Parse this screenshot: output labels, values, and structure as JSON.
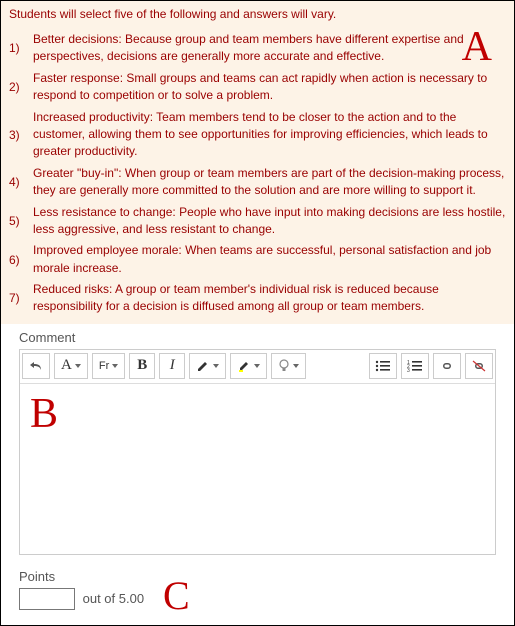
{
  "instruction": "Students will select five of the following and answers will vary.",
  "items": [
    {
      "n": "1)",
      "text": "Better decisions: Because group and team members have different expertise and perspectives, decisions are generally more accurate and effective."
    },
    {
      "n": "2)",
      "text": "Faster response: Small groups and teams can act rapidly when action is necessary to respond to competition or to solve a problem."
    },
    {
      "n": "3)",
      "text": "Increased productivity: Team members tend to be closer to the action and to the customer, allowing them to see opportunities for improving efficiencies, which leads to greater productivity."
    },
    {
      "n": "4)",
      "text": "Greater \"buy-in\": When group or team members are part of the decision-making process, they are generally more committed to the solution and are more willing to support it."
    },
    {
      "n": "5)",
      "text": "Less resistance to change: People who have input into making decisions are less hostile, less aggressive, and less resistant to change."
    },
    {
      "n": "6)",
      "text": "Improved employee morale: When teams are successful, personal satisfaction and job morale increase."
    },
    {
      "n": "7)",
      "text": "Reduced risks: A group or team member's individual risk is reduced because responsibility for a decision is diffused among all group or team members."
    }
  ],
  "comment_label": "Comment",
  "toolbar": {
    "undo": "↩",
    "font_label": "A",
    "font_family": "Fr",
    "bold": "B",
    "italic": "I"
  },
  "editor_content": "B",
  "points": {
    "label": "Points",
    "value": "",
    "suffix": "out of 5.00"
  },
  "overlays": {
    "A": "A",
    "C": "C"
  }
}
